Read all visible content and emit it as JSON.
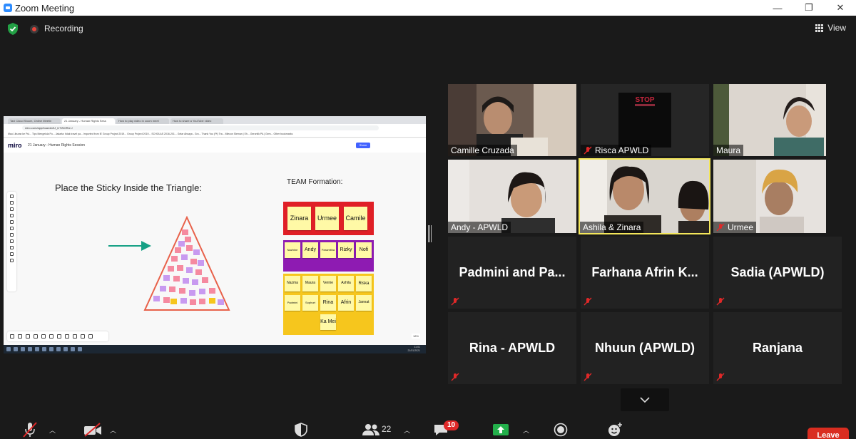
{
  "window": {
    "title": "Zoom Meeting",
    "controls": {
      "minimize": "—",
      "maximize": "❐",
      "close": "✕"
    }
  },
  "status": {
    "recording_label": "Recording",
    "view_label": "View",
    "icons": [
      "shield-icon",
      "recording-icon",
      "grid-view-icon"
    ]
  },
  "shared_screen": {
    "browser_tabs": [
      "Taxi Cloud Stoom, Online Meetin",
      "21 January - Human Rights Sess",
      "How to play video in zoom meet",
      "How to share a YouTube video"
    ],
    "url": "miro.com/app/board/o9J_lJTWORU=/",
    "bookmarks": "Mau Liburan ke Pul...   Tips Mengelola Pu...   Jakarta: tidak travel pa...   Imported from IE   Group Project 2019...   Group Project 2019...   SCHOLAS 2016-201...   Gelar Ahsaya - Gro...   Thank You (Pt) Tra...   Mlecon Sleman | Eh...   Gerontik PA | Gem...   Other bookmarks",
    "miro": {
      "logo": "miro",
      "board_title": "21 January - Human Rights Session",
      "share_label": "Share",
      "zoom": "18%"
    },
    "taskbar_time": "11:01",
    "taskbar_date": "21/01/2021",
    "board": {
      "pyramid_title": "Place the Sticky Inside the Triangle:",
      "team_title": "TEAM Formation:",
      "red_row": [
        "Zinara",
        "Urmee",
        "Camile"
      ],
      "purple_row": [
        "Nazhine",
        "Andy",
        "Paramitha",
        "Rizky",
        "Nofi"
      ],
      "yellow_row1": [
        "Nazma",
        "Maura",
        "Vernie",
        "Ashila",
        "Riska"
      ],
      "yellow_row2": [
        "Padmini",
        "Sophort",
        "Rina",
        "Afrin",
        "Jannat"
      ],
      "yellow_row3": [
        "Ka Mei"
      ],
      "colors": {
        "red": "#e01f26",
        "purple": "#8e1bb2",
        "yellow": "#f6c61d",
        "arrow": "#16a085",
        "triangle": "#e8614a"
      }
    }
  },
  "participants": [
    {
      "name": "Camille Cruzada",
      "muted": false,
      "video": true
    },
    {
      "name": "Risca APWLD",
      "muted": true,
      "video": true
    },
    {
      "name": "Maura",
      "muted": false,
      "video": true
    },
    {
      "name": "Andy - APWLD",
      "muted": false,
      "video": true
    },
    {
      "name": "Ashila & Zinara",
      "muted": false,
      "video": true,
      "active_speaker": true
    },
    {
      "name": "Urmee",
      "muted": true,
      "video": true
    },
    {
      "name": "Padmini and Pa...",
      "muted": true,
      "video": false
    },
    {
      "name": "Farhana Afrin K...",
      "muted": true,
      "video": false
    },
    {
      "name": "Sadia (APWLD)",
      "muted": true,
      "video": false
    },
    {
      "name": "Rina - APWLD",
      "muted": true,
      "video": false
    },
    {
      "name": "Nhuun (APWLD)",
      "muted": true,
      "video": false
    },
    {
      "name": "Ranjana",
      "muted": true,
      "video": false
    }
  ],
  "toolbar": {
    "participants_count": "22",
    "chat_badge": "10",
    "leave_label": "Leave",
    "icons": [
      "microphone-muted-icon",
      "video-off-icon",
      "security-shield-icon",
      "participants-icon",
      "chat-icon",
      "share-screen-icon",
      "record-icon",
      "reactions-icon"
    ]
  }
}
